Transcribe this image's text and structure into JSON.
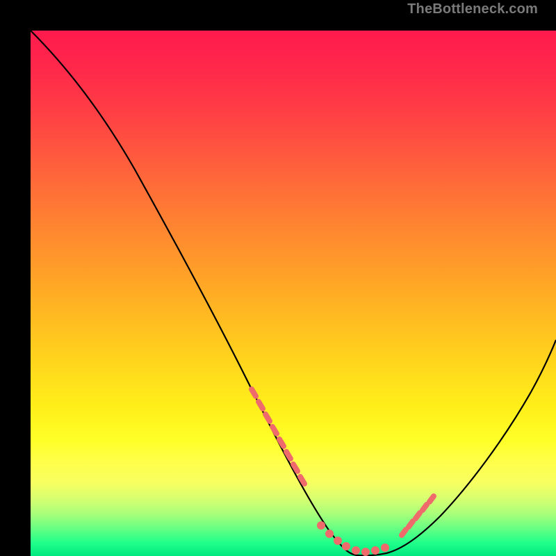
{
  "watermark": "TheBottleneck.com",
  "colors": {
    "frame": "#000000",
    "curve": "#000000",
    "markers": "#ef6b6b",
    "gradient_top": "#ff1a4d",
    "gradient_bottom": "#00e880"
  },
  "chart_data": {
    "type": "line",
    "title": "",
    "xlabel": "",
    "ylabel": "",
    "xlim": [
      0,
      100
    ],
    "ylim": [
      0,
      100
    ],
    "annotations": [],
    "series": [
      {
        "name": "bottleneck-curve",
        "x": [
          0,
          5,
          10,
          15,
          20,
          25,
          30,
          35,
          40,
          45,
          50,
          53,
          56,
          58,
          60,
          62,
          65,
          68,
          72,
          76,
          80,
          84,
          88,
          92,
          96,
          100
        ],
        "values": [
          100,
          93,
          85,
          77,
          69,
          60,
          51,
          42,
          33,
          24,
          15,
          10,
          5,
          2,
          0,
          0,
          0,
          1,
          3,
          7,
          12,
          18,
          25,
          33,
          42,
          52
        ]
      }
    ],
    "markers": {
      "name": "highlighted-points",
      "left_cluster": {
        "x_range": [
          40,
          50
        ],
        "y_range": [
          14,
          32
        ]
      },
      "bottom_cluster": {
        "x_range": [
          50,
          66
        ],
        "y_range": [
          0,
          3
        ]
      },
      "right_cluster": {
        "x_range": [
          66,
          76
        ],
        "y_range": [
          2,
          10
        ]
      }
    }
  }
}
